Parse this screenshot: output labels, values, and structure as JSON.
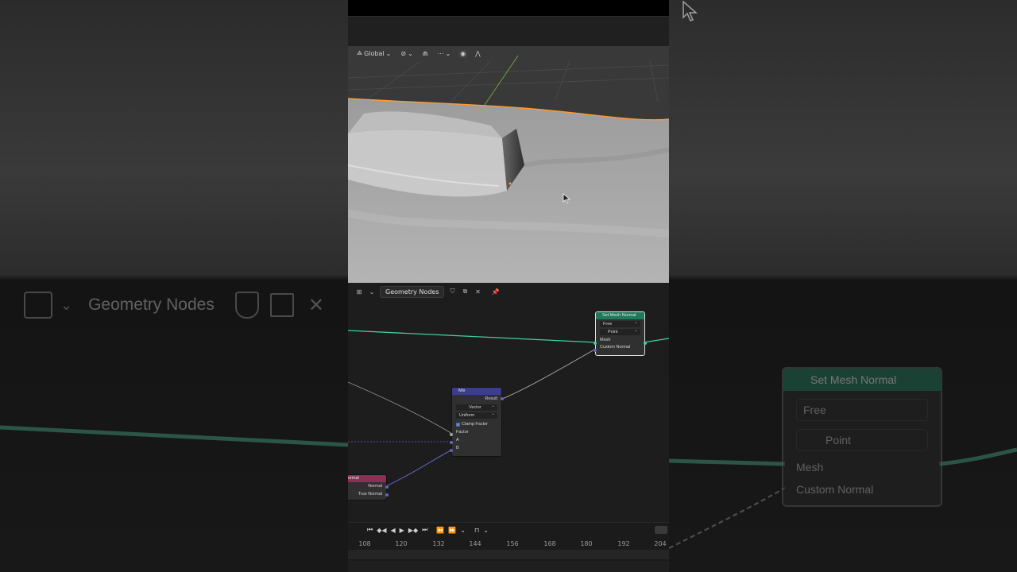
{
  "viewport": {
    "orientation_label": "Global",
    "accent_selection": "#ff9a2e",
    "grid_axis_color": "#6fa33a"
  },
  "node_editor": {
    "editor_name": "Geometry Nodes",
    "link_color_geometry": "#3fd1a0",
    "link_color_vector": "#6363c7",
    "nodes": {
      "set_mesh_normal": {
        "title": "Set Mesh Normal",
        "mode": "Free",
        "domain": "Point",
        "input_mesh": "Mesh",
        "input_custom_normal": "Custom Normal",
        "header_color": "#1f7a5b"
      },
      "mix": {
        "title": "Mix",
        "output_result": "Result",
        "data_type": "Vector",
        "factor_mode": "Uniform",
        "clamp_factor_label": "Clamp Factor",
        "clamp_factor": true,
        "input_factor": "Factor",
        "input_a": "A",
        "input_b": "B",
        "header_color": "#3d3d8f"
      },
      "normal": {
        "title": "ormal",
        "output_normal": "Normal",
        "output_true_normal": "True Normal",
        "header_color": "#8e2e55"
      }
    }
  },
  "timeline": {
    "frame_ticks": [
      "108",
      "120",
      "132",
      "144",
      "156",
      "168",
      "180",
      "192",
      "204"
    ]
  },
  "background_zoom": {
    "editor_name": "Geometry Nodes",
    "node_title": "Set Mesh Normal",
    "mode": "Free",
    "domain": "Point",
    "input_mesh": "Mesh",
    "input_custom_normal": "Custom Normal"
  }
}
